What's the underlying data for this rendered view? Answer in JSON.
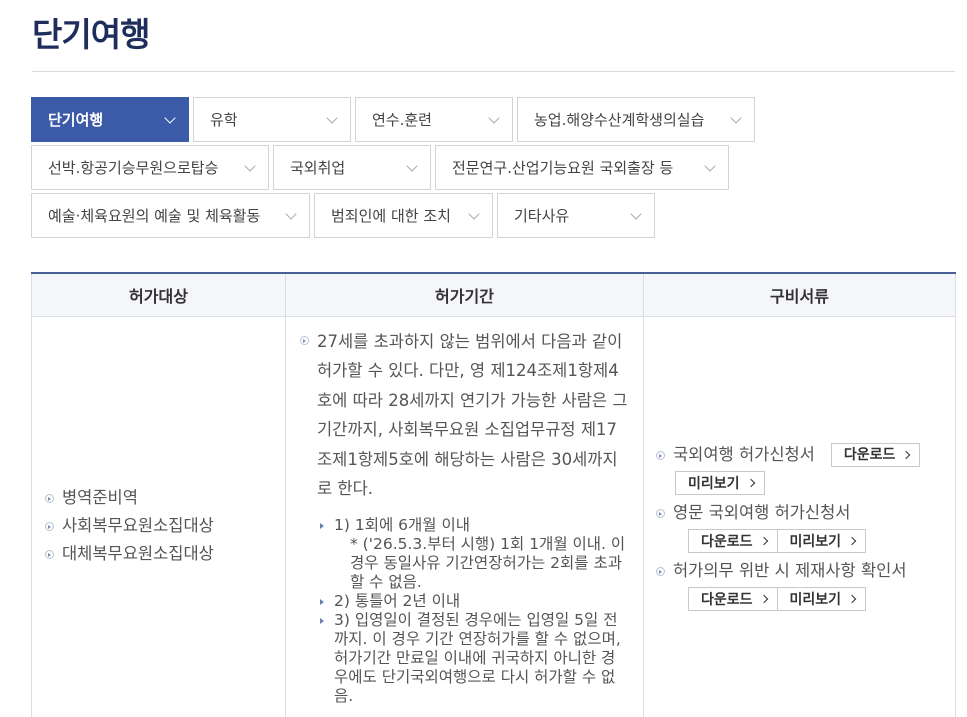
{
  "page": {
    "title": "단기여행"
  },
  "tabs": [
    [
      {
        "label": "단기여행",
        "active": true
      },
      {
        "label": "유학"
      },
      {
        "label": "연수.훈련"
      },
      {
        "label": "농업.해양수산계학생의실습"
      }
    ],
    [
      {
        "label": "선박.항공기승무원으로탑승"
      },
      {
        "label": "국외취업"
      },
      {
        "label": "전문연구.산업기능요원 국외출장 등"
      }
    ],
    [
      {
        "label": "예술·체육요원의 예술 및 체육활동"
      },
      {
        "label": "범죄인에 대한 조치"
      },
      {
        "label": "기타사유"
      }
    ]
  ],
  "table": {
    "headers": [
      "허가대상",
      "허가기간",
      "구비서류"
    ],
    "targets": [
      "병역준비역",
      "사회복무요원소집대상",
      "대체복무요원소집대상"
    ],
    "period": {
      "main": "27세를 초과하지 않는 범위에서 다음과 같이 허가할 수 있다. 다만, 영 제124조제1항제4호에 따라 28세까지 연기가 가능한 사람은 그 기간까지, 사회복무요원 소집업무규정 제17조제1항제5호에 해당하는 사람은 30세까지로 한다.",
      "item1": "1) 1회에 6개월 이내",
      "item1_note": "* ('26.5.3.부터 시행) 1회 1개월 이내. 이 경우 동일사유 기간연장허가는 2회를 초과할 수 없음.",
      "item2": "2) 통틀어 2년 이내",
      "item3": "3) 입영일이 결정된 경우에는 입영일 5일 전까지. 이 경우 기간 연장허가를 할 수 없으며, 허가기간 만료일 이내에 귀국하지 아니한 경우에도 단기국외여행으로 다시 허가할 수 없음."
    },
    "docs": [
      {
        "name": "국외여행 허가신청서"
      },
      {
        "name": "영문 국외여행 허가신청서"
      },
      {
        "name": "허가의무 위반 시 제재사항 확인서"
      }
    ],
    "download_label": "다운로드",
    "preview_label": "미리보기"
  }
}
